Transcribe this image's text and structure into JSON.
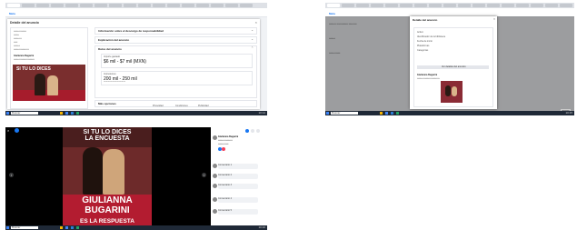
{
  "screenshot1": {
    "app_name": "Meta",
    "modal_title": "Detalle del anuncio",
    "advertiser": "Giulianna Bugarini",
    "ad_caption": "SI TU LO DICES",
    "sections": [
      "Información sobre el descargo de responsabilidad",
      "Explicación del anuncio",
      "Datos del anuncio"
    ],
    "stats": [
      {
        "label": "Importe gastado",
        "value": "$6 mil - $7 mil (MXN)",
        "note": ""
      },
      {
        "label": "Impresiones",
        "value": "200 mil - 250 mil",
        "note": ""
      }
    ],
    "more_section": "Más opciones",
    "footer_links": [
      "Privacidad",
      "Condiciones",
      "Publicidad"
    ],
    "search_placeholder": "Buscar",
    "clock": "10:14"
  },
  "screenshot2": {
    "app_name": "Meta",
    "modal_title": "Detalle del anuncio",
    "modal_subtitle": "",
    "card_lines": [
      "Activo",
      "Identificador de la biblioteca",
      "Fecha de inicio",
      "Plataformas",
      "Categorías"
    ],
    "details_button": "Ver detalles del anuncio",
    "advertiser": "Giulianna Bugarini",
    "close_button": "Cerrar",
    "search_placeholder": "Buscar",
    "clock": "10:15"
  },
  "screenshot3": {
    "poster_line1": "SI TU LO DICES",
    "poster_line2": "LA ENCUESTA",
    "poster_name1": "GIULIANNA",
    "poster_name2": "BUGARINI",
    "poster_tagline": "ES LA RESPUESTA",
    "page_name": "Giulianna Bugarini",
    "comment_authors": [
      "Comentario 1",
      "Comentario 2",
      "Comentario 3",
      "Comentario 4",
      "Comentario 5"
    ],
    "search_placeholder": "Buscar",
    "clock": "10:16"
  },
  "colors": {
    "facebook_blue": "#1877f2",
    "brand_red": "#b31c30",
    "taskbar": "#1f2937"
  }
}
